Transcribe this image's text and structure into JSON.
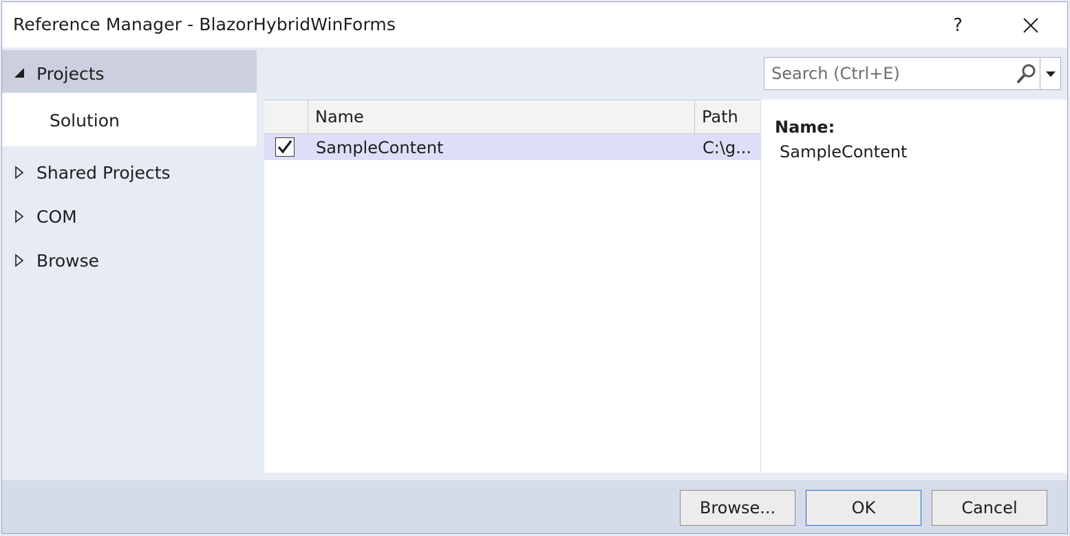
{
  "window": {
    "title": "Reference Manager - BlazorHybridWinForms",
    "help_label": "?",
    "close_icon": "close-icon"
  },
  "nav": {
    "items": [
      {
        "label": "Projects",
        "icon": "triangle-expanded-icon",
        "selected": true
      },
      {
        "label": "Solution",
        "active": true
      },
      {
        "label": "Shared Projects",
        "icon": "triangle-collapsed-icon"
      },
      {
        "label": "COM",
        "icon": "triangle-collapsed-icon"
      },
      {
        "label": "Browse",
        "icon": "triangle-collapsed-icon"
      }
    ]
  },
  "search": {
    "placeholder": "Search (Ctrl+E)",
    "value": ""
  },
  "list": {
    "columns": [
      "",
      "Name",
      "Path"
    ],
    "rows": [
      {
        "checked": true,
        "name": "SampleContent",
        "path": "C:\\g..."
      }
    ]
  },
  "details": {
    "name_label": "Name:",
    "name_value": "SampleContent"
  },
  "footer": {
    "browse_label": "Browse...",
    "ok_label": "OK",
    "cancel_label": "Cancel"
  },
  "colors": {
    "accent": "#1e6fd0",
    "selected_row": "#dcdff7",
    "nav_selected": "#ccd0de",
    "panel_bg": "#e7ebf4"
  }
}
